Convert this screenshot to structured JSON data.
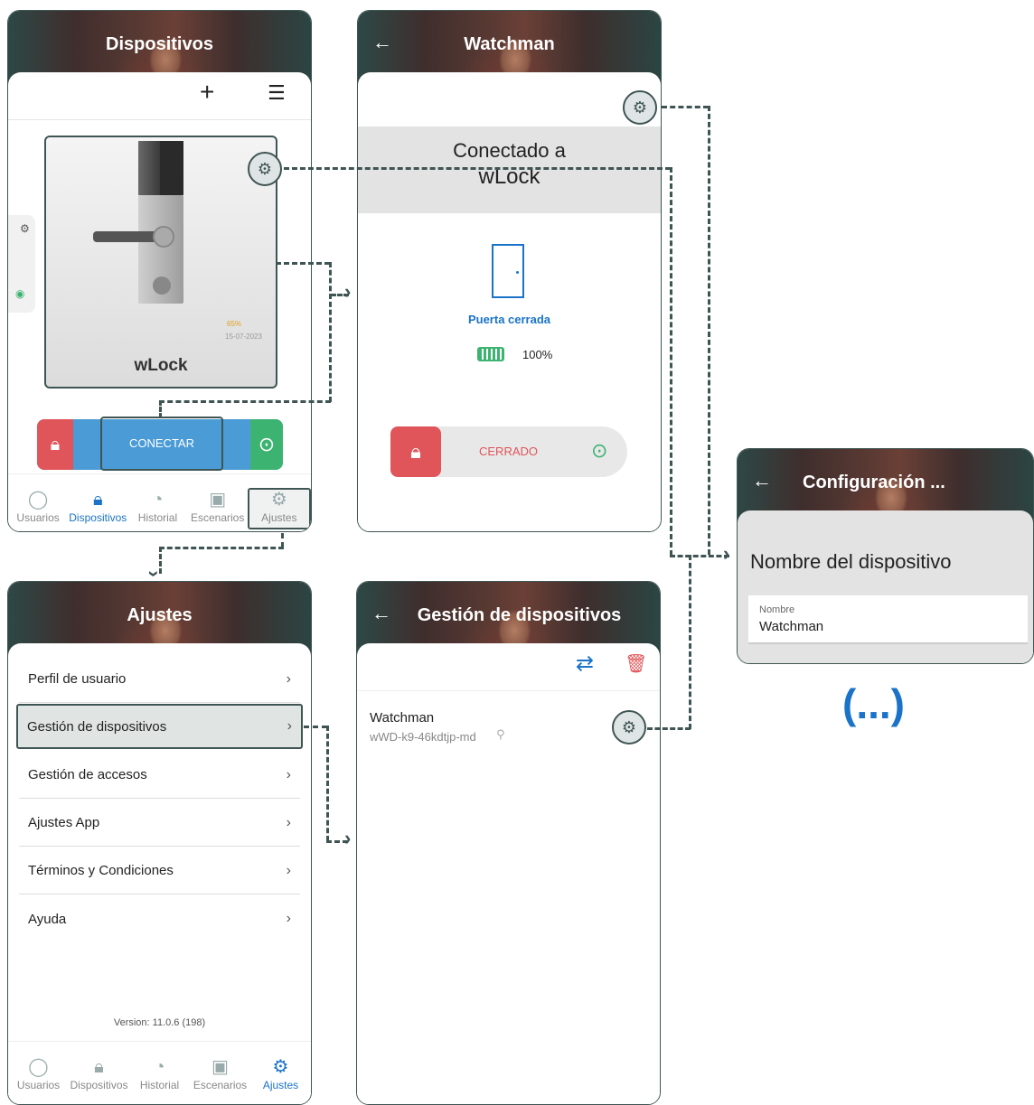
{
  "screen1": {
    "title": "Dispositivos",
    "add_icon": "+",
    "list_icon": "☰",
    "battery_small": "65%",
    "date_small": "15-07-2023",
    "device_name": "wLock",
    "connect_label": "CONECTAR"
  },
  "tabs": [
    "Usuarios",
    "Dispositivos",
    "Historial",
    "Escenarios",
    "Ajustes"
  ],
  "screen2": {
    "title": "Watchman",
    "connected_line1": "Conectado a",
    "connected_line2": "wLock",
    "door_status": "Puerta cerrada",
    "battery": "100%",
    "lock_state": "CERRADO"
  },
  "screen3": {
    "title": "Ajustes",
    "menu": [
      "Perfil de usuario",
      "Gestión de dispositivos",
      "Gestión de accesos",
      "Ajustes App",
      "Términos y Condiciones",
      "Ayuda"
    ],
    "version": "Version: 11.0.6 (198)"
  },
  "screen4": {
    "title": "Gestión de dispositivos",
    "device_name": "Watchman",
    "device_id": "wWD-k9-46kdtjp-md"
  },
  "screen5": {
    "title": "Configuración ...",
    "section_title": "Nombre del dispositivo",
    "field_label": "Nombre",
    "field_value": "Watchman"
  },
  "ellipsis": "(...)",
  "colors": {
    "accent_blue": "#1a73c8",
    "connect_blue": "#4a9bd6",
    "lock_red": "#e0555a",
    "unlock_green": "#3cb371",
    "dash_gray": "#3f5553"
  }
}
